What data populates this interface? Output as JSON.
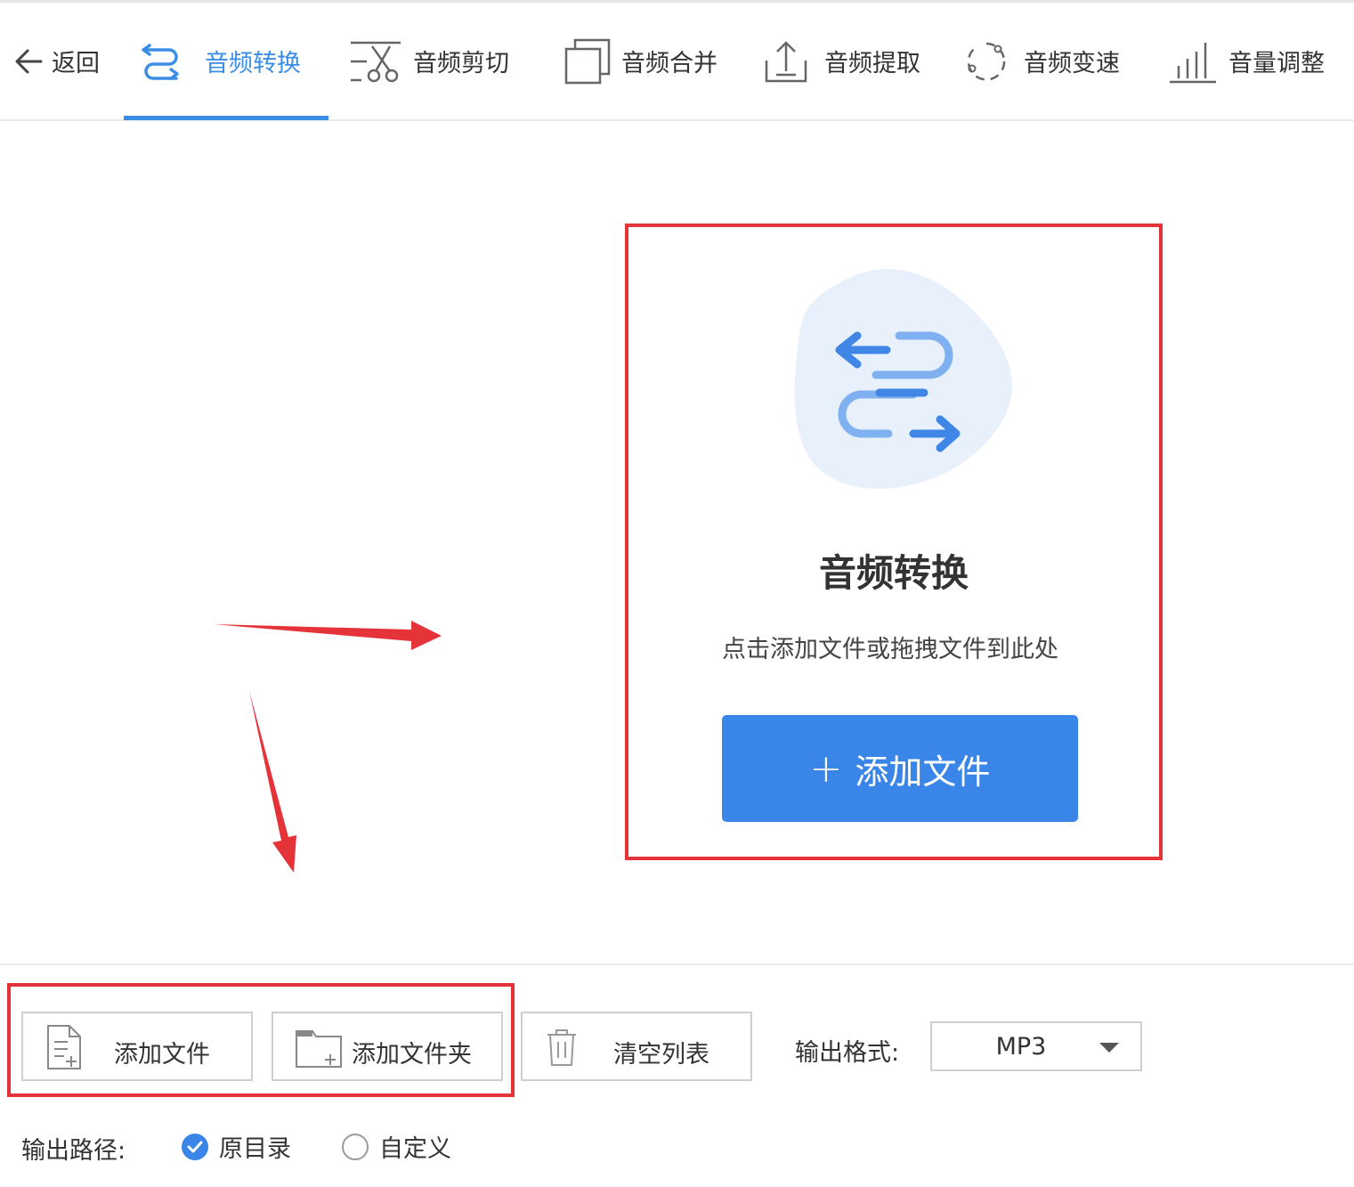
{
  "toolbar": {
    "back_label": "返回",
    "tabs": [
      {
        "label": "音频转换",
        "icon": "convert-icon",
        "active": true
      },
      {
        "label": "音频剪切",
        "icon": "scissors-icon",
        "active": false
      },
      {
        "label": "音频合并",
        "icon": "merge-icon",
        "active": false
      },
      {
        "label": "音频提取",
        "icon": "extract-icon",
        "active": false
      },
      {
        "label": "音频变速",
        "icon": "speed-icon",
        "active": false
      },
      {
        "label": "音量调整",
        "icon": "volume-icon",
        "active": false
      }
    ]
  },
  "drop_area": {
    "title": "音频转换",
    "subtitle": "点击添加文件或拖拽文件到此处",
    "add_button_plus": "+",
    "add_button_label": "添加文件"
  },
  "bottom_bar": {
    "add_file_label": "添加文件",
    "add_folder_label": "添加文件夹",
    "clear_list_label": "清空列表",
    "output_format_label": "输出格式:",
    "output_format_value": "MP3",
    "output_path_label": "输出路径:",
    "path_option_original": "原目录",
    "path_option_custom": "自定义",
    "path_selected": "原目录"
  },
  "colors": {
    "accent": "#3a86e8",
    "highlight_red": "#e5333a"
  }
}
